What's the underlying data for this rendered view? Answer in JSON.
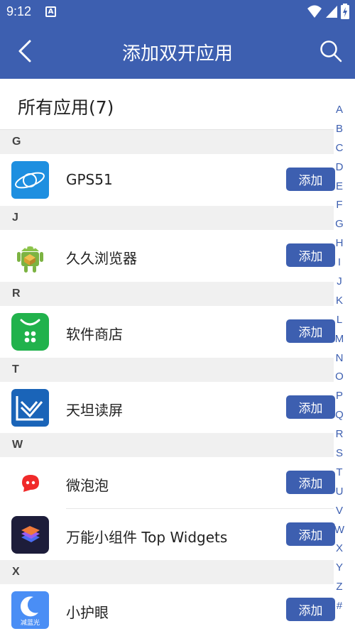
{
  "status_bar": {
    "time": "9:12",
    "notif_glyph": "A"
  },
  "app_bar": {
    "title": "添加双开应用"
  },
  "list": {
    "title": "所有应用(7)"
  },
  "sections": [
    {
      "letter": "G",
      "apps": [
        {
          "name": "GPS51",
          "button": "添加",
          "icon": "gps51-icon"
        }
      ]
    },
    {
      "letter": "J",
      "apps": [
        {
          "name": "久久浏览器",
          "button": "添加",
          "icon": "android-browser-icon"
        }
      ]
    },
    {
      "letter": "R",
      "apps": [
        {
          "name": "软件商店",
          "button": "添加",
          "icon": "app-store-icon"
        }
      ]
    },
    {
      "letter": "T",
      "apps": [
        {
          "name": "天坦读屏",
          "button": "添加",
          "icon": "screen-reader-icon"
        }
      ]
    },
    {
      "letter": "W",
      "apps": [
        {
          "name": "微泡泡",
          "button": "添加",
          "icon": "bubble-icon"
        },
        {
          "name": "万能小组件 Top Widgets",
          "button": "添加",
          "icon": "widgets-icon"
        }
      ]
    },
    {
      "letter": "X",
      "apps": [
        {
          "name": "小护眼",
          "button": "添加",
          "icon": "eye-care-icon",
          "icon_caption": "减蓝光"
        }
      ]
    }
  ],
  "alphabet_index": [
    "A",
    "B",
    "C",
    "D",
    "E",
    "F",
    "G",
    "H",
    "I",
    "J",
    "K",
    "L",
    "M",
    "N",
    "O",
    "P",
    "Q",
    "R",
    "S",
    "T",
    "U",
    "V",
    "W",
    "X",
    "Y",
    "Z",
    "#"
  ],
  "colors": {
    "primary": "#3d5fb0",
    "section_bg": "#f0f0f0"
  }
}
